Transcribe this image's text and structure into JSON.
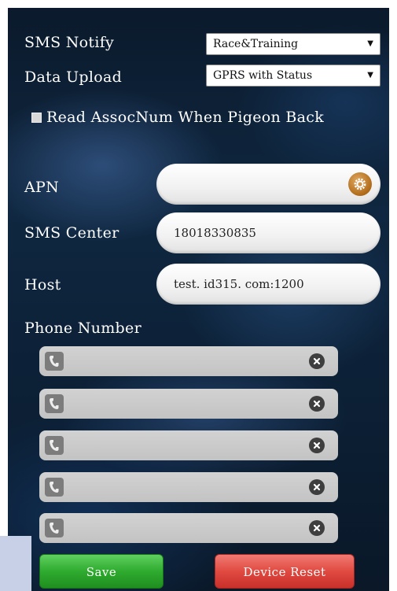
{
  "settings": {
    "sms_notify": {
      "label": "SMS Notify",
      "value": "Race&Training"
    },
    "data_upload": {
      "label": "Data Upload",
      "value": "GPRS with Status"
    },
    "read_assoc": {
      "label": "Read AssocNum When Pigeon Back",
      "checked": true
    }
  },
  "network": {
    "apn": {
      "label": "APN",
      "value": "",
      "icon": "gear-icon"
    },
    "sms_center": {
      "label": "SMS Center",
      "value": "18018330835"
    },
    "host": {
      "label": "Host",
      "value": "test. id315. com:1200"
    }
  },
  "phone_numbers": {
    "label": "Phone Number",
    "entries": [
      "",
      "",
      "",
      "",
      ""
    ]
  },
  "actions": {
    "save_label": "Save",
    "reset_label": "Device Reset"
  },
  "colors": {
    "save": "#2fab2f",
    "reset": "#e04a41",
    "gear": "#b06a18"
  }
}
